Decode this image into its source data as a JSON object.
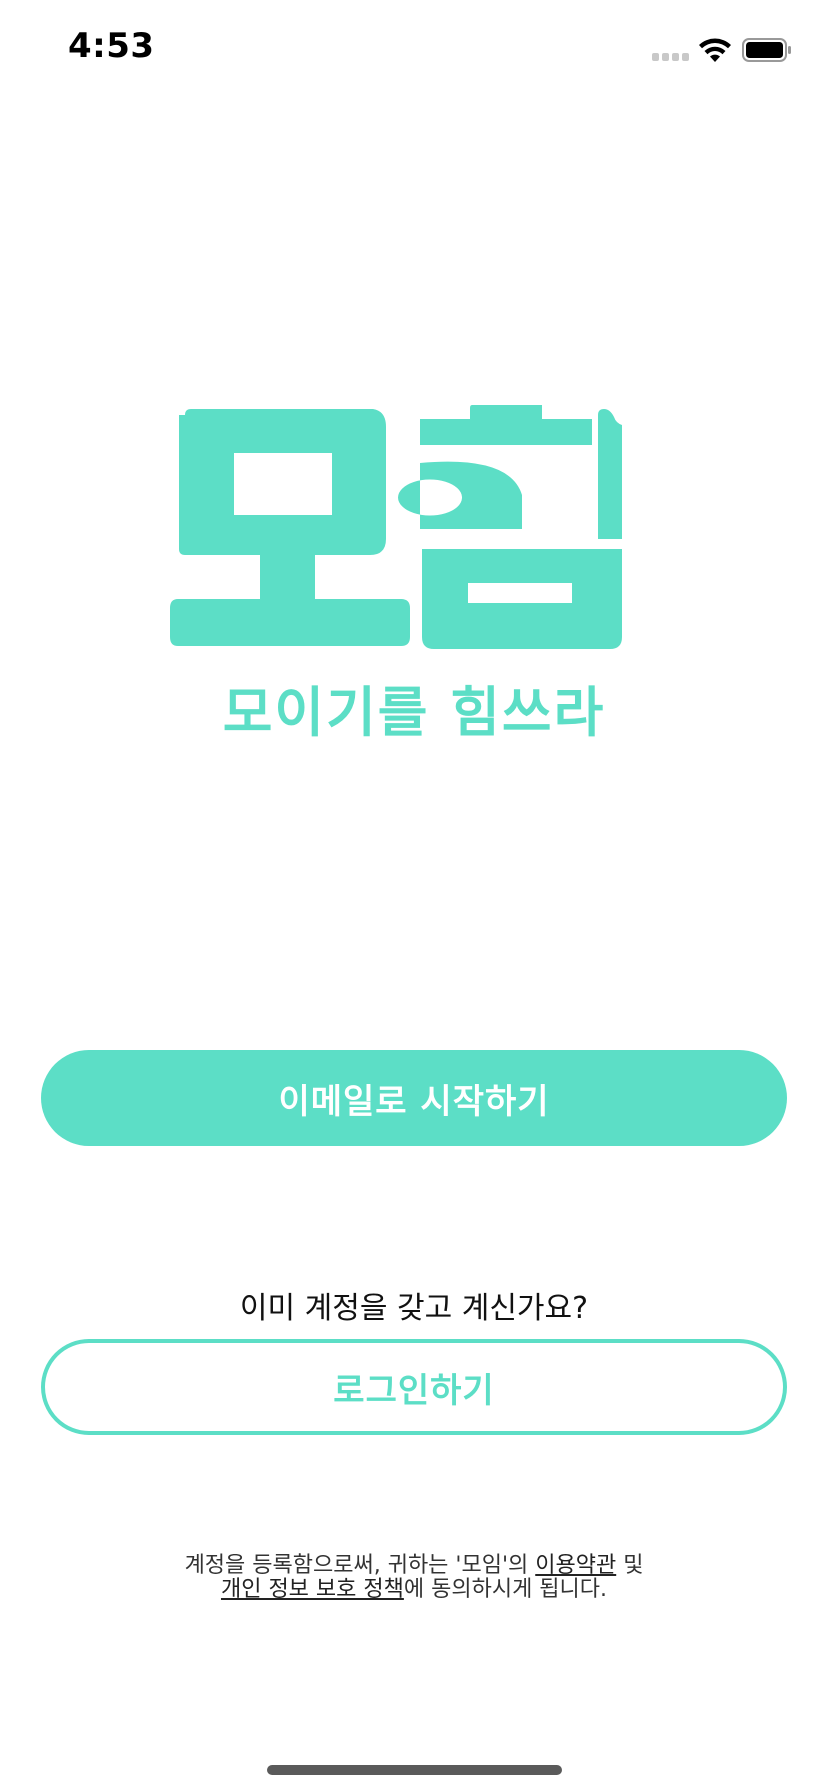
{
  "status_bar": {
    "time": "4:53",
    "icons": [
      "signal-icon",
      "wifi-icon",
      "battery-icon"
    ]
  },
  "brand": {
    "logo_text": "모힘",
    "tagline": "모이기를 힘쓰라",
    "accent_color": "#5cdec6"
  },
  "actions": {
    "email_start_label": "이메일로 시작하기",
    "already_have_account": "이미 계정을 갖고 계신가요?",
    "login_label": "로그인하기"
  },
  "terms": {
    "part1": "계정을 등록함으로써, 귀하는 '모임'의 ",
    "terms_link": "이용약관",
    "part2": " 및",
    "privacy_link": "개인 정보 보호 정책",
    "part3": "에 동의하시게 됩니다."
  }
}
